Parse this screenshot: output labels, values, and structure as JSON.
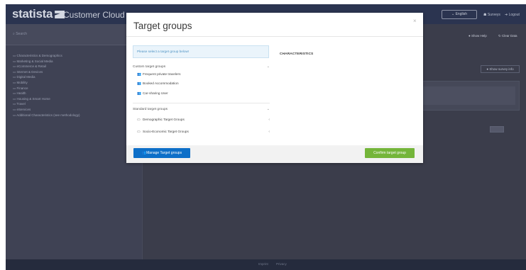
{
  "app": {
    "logo_text": "statista",
    "title": "Customer Cloud",
    "language": "English",
    "surveys_label": "Surveys",
    "logout_label": "Logout",
    "search_placeholder": "Search",
    "show_help_label": "Show Help",
    "clear_data_label": "Clear Data",
    "survey_info_label": "Show survey info",
    "footer": {
      "imprint": "Imprint",
      "privacy": "Privacy"
    },
    "sidebar_categories": [
      "Characteristics & Demographics",
      "Marketing & Social Media",
      "eCommerce & Retail",
      "Internet & Devices",
      "Digital Media",
      "Mobility",
      "Finance",
      "Health",
      "Housing & Smart Home",
      "Travel",
      "eServices",
      "Additional Characteristics (see methodology)"
    ]
  },
  "modal": {
    "title": "Target groups",
    "close_glyph": "×",
    "info_text": "Please select a target group below!",
    "custom_section": {
      "label": "Custom target groups",
      "items": [
        "Frequent private travelers",
        "Booked Accommodation",
        "Car-sharing User"
      ]
    },
    "standard_section": {
      "label": "Standard target groups",
      "items": [
        "Demographic Target Groups",
        "Socio-Economic Target Groups"
      ]
    },
    "characteristics_heading": "CHARACTERISTICS",
    "manage_button": "Manage Target groups",
    "confirm_button": "Confirm target group"
  },
  "colors": {
    "primary_blue": "#0d6fc8",
    "confirm_green": "#74b53a",
    "topbar": "#2b3450"
  }
}
